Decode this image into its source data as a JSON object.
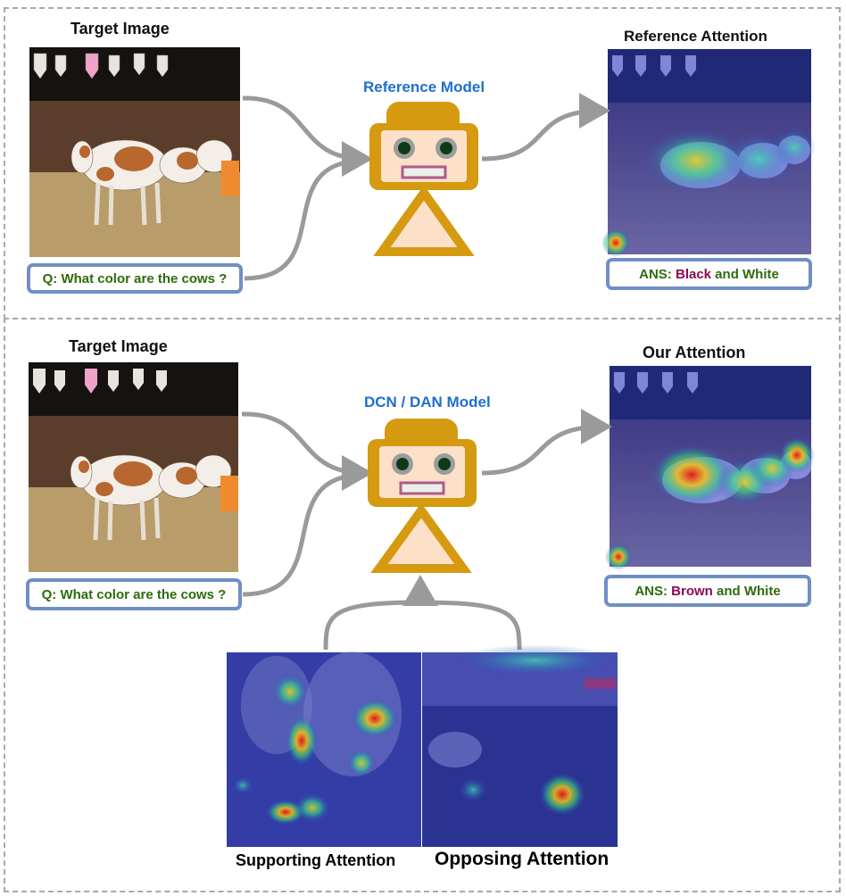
{
  "panels": [
    {
      "target_title": "Target Image",
      "model_title": "Reference Model",
      "attention_title": "Reference Attention",
      "question": "Q: What color are the cows ?",
      "answer": {
        "prefix": "ANS: ",
        "highlight": "Black",
        "suffix": " and White"
      }
    },
    {
      "target_title": "Target Image",
      "model_title": "DCN / DAN Model",
      "attention_title": "Our Attention",
      "question": "Q: What color are the cows ?",
      "answer": {
        "prefix": "ANS: ",
        "highlight": "Brown",
        "suffix": " and White"
      }
    }
  ],
  "bottom": {
    "supporting_label": "Supporting Attention",
    "opposing_label": "Opposing Attention"
  },
  "colors": {
    "model_title": "#1f6fd0",
    "question_text": "#2e6b0c",
    "answer_highlight": "#8a0a56",
    "box_border": "#6f8fc5",
    "robot_body": "#d69a10",
    "robot_face": "#fde0c8",
    "arrow": "#9a9a9a"
  }
}
